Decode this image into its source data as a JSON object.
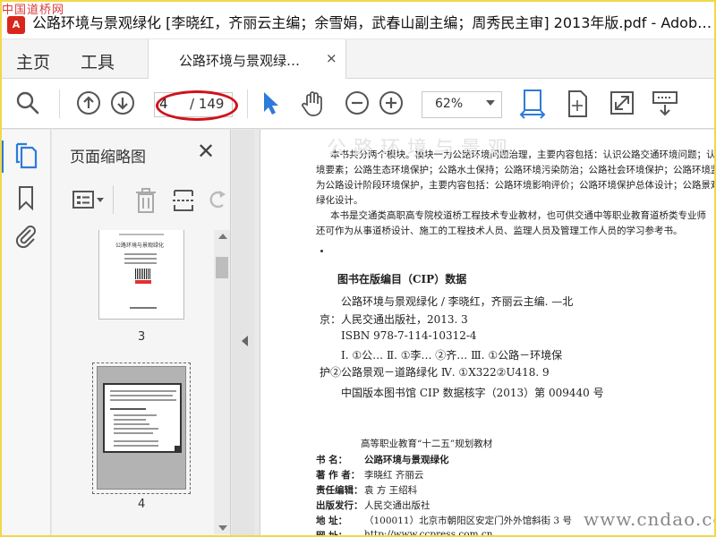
{
  "watermark_top": "中国道桥网",
  "window": {
    "title": "公路环境与景观绿化 [李晓红，齐丽云主编；余雪娟，武春山副主编；周秀民主审] 2013年版.pdf - Adob…",
    "app_icon": "acrobat-icon"
  },
  "menu": {
    "home": "主页",
    "tools": "工具"
  },
  "doc_tab": {
    "label": "公路环境与景观绿…",
    "close": "×"
  },
  "toolbar": {
    "page_current": "4",
    "page_total": "/ 149",
    "zoom": "62%",
    "icons": [
      "search-icon",
      "page-up-icon",
      "page-down-icon",
      "select-cursor-icon",
      "hand-icon",
      "zoom-out-icon",
      "zoom-in-icon",
      "fit-width-icon",
      "fit-page-icon",
      "fullscreen-icon",
      "read-mode-icon"
    ]
  },
  "rail": {
    "icons": [
      "page-thumbnails-icon",
      "bookmarks-icon",
      "attachments-icon"
    ]
  },
  "thumbnails": {
    "title": "页面缩略图",
    "close": "✕",
    "pages": [
      {
        "number": "3",
        "caption": "公路环境与景观绿化"
      },
      {
        "number": "4"
      }
    ]
  },
  "document": {
    "para1": [
      "本书共分两个模块。模块一为公路环境问题治理，主要内容包括：认识公路交通环境问题；认",
      "境要素；公路生态环境保护；公路水土保持；公路环境污染防治；公路社会环境保护；公路环境监理",
      "为公路设计阶段环境保护，主要内容包括：公路环境影响评价；公路环境保护总体设计；公路景观设",
      "绿化设计。"
    ],
    "para2": [
      "本书是交通类高职高专院校道桥工程技术专业教材，也可供交通中等职业教育道桥类专业师",
      "还可作为从事道桥设计、施工的工程技术人员、监理人员及管理工作人员的学习参考书。"
    ],
    "cip_heading": "图书在版编目（CIP）数据",
    "cip_lines": [
      "公路环境与景观绿化 / 李晓红，齐丽云主编. —北",
      "京：人民交通出版社，2013. 3",
      "ISBN 978-7-114-10312-4",
      "Ⅰ. ①公…   Ⅱ. ①李…   ②齐…   Ⅲ. ①公路－环境保",
      "护②公路景观－道路绿化   Ⅳ. ①X322②U418. 9",
      "中国版本图书馆 CIP 数据核字（2013）第 009440 号"
    ],
    "watermark_page": "公路环境与景观",
    "series_title": "高等职业教育“十二五”规划教材",
    "colophon": [
      {
        "label": "书      名：",
        "value": "公路环境与景观绿化"
      },
      {
        "label": "著  作  者：",
        "value": "李晓红   齐丽云"
      },
      {
        "label": "责任编辑：",
        "value": "袁   方   王绍科"
      },
      {
        "label": "出版发行：",
        "value": "人民交通出版社"
      },
      {
        "label": "地      址：",
        "value": "（100011）北京市朝阳区安定门外外馆斜街 3 号"
      },
      {
        "label": "网      址：",
        "value": "http://www.ccpress.com.cn"
      }
    ]
  },
  "watermark_bottom": "www.cndao.com",
  "colors": {
    "accent": "#2d7bd8",
    "highlight": "#d0121b",
    "frame": "#f1d84a"
  }
}
